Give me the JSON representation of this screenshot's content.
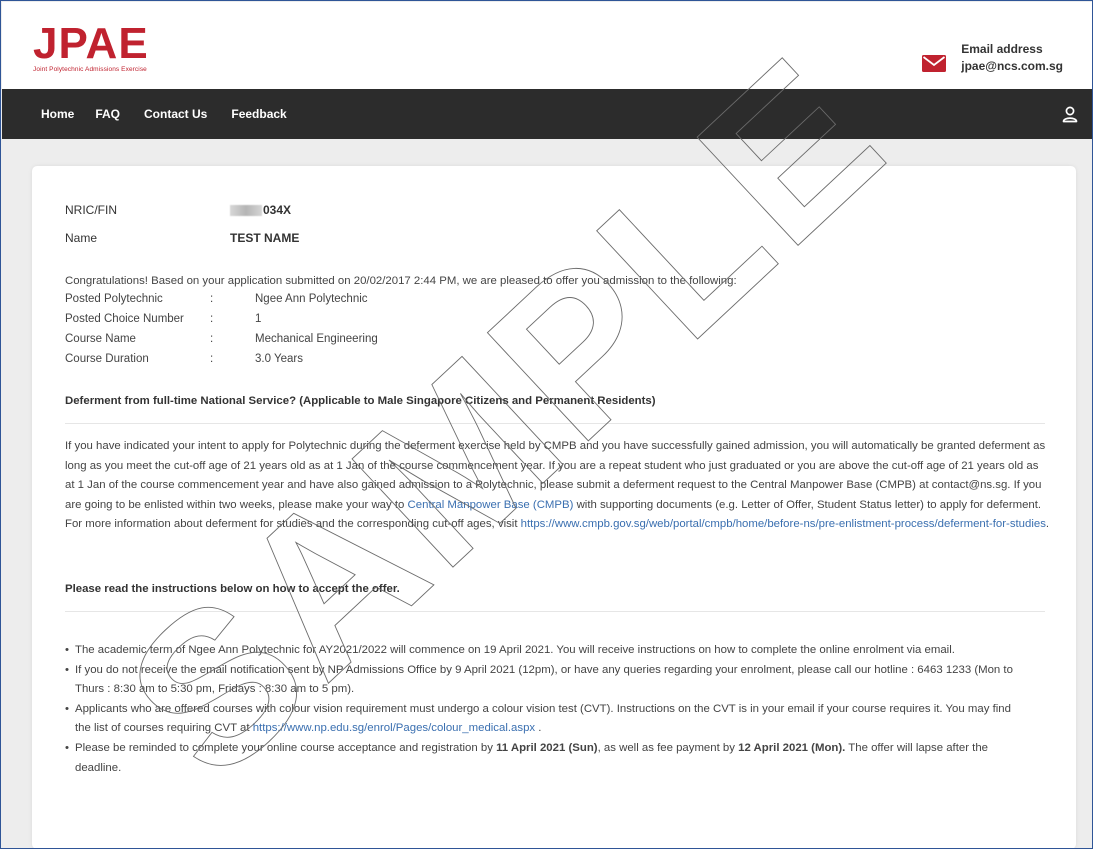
{
  "header": {
    "logo_text": "JPAE",
    "logo_subtitle": "Joint Polytechnic Admissions Exercise",
    "email_label": "Email address",
    "email_value": "jpae@ncs.com.sg"
  },
  "nav": {
    "items": [
      "Home",
      "FAQ",
      "Contact Us",
      "Feedback"
    ],
    "user_icon": "user-icon"
  },
  "profile": {
    "nric_label": "NRIC/FIN",
    "nric_value": "034X",
    "name_label": "Name",
    "name_value": "TEST NAME"
  },
  "offer": {
    "intro": "Congratulations! Based on your application submitted on 20/02/2017 2:44 PM, we are pleased to offer you admission to the following:",
    "separator": ":",
    "details": [
      {
        "label": "Posted Polytechnic",
        "value": "Ngee Ann Polytechnic"
      },
      {
        "label": "Posted Choice  Number",
        "value": "1"
      },
      {
        "label": "Course Name",
        "value": "Mechanical Engineering"
      },
      {
        "label": "Course Duration",
        "value": "3.0 Years"
      }
    ]
  },
  "deferment": {
    "heading": "Deferment from full-time National Service? (Applicable to Male Singapore Citizens and Permanent Residents)",
    "text_1": "If you have indicated your intent to apply for Polytechnic during the deferment exercise held by CMPB and you have successfully gained admission, you will automatically be granted deferment as long as you meet the cut-off age of 21 years old as at 1 Jan of the course commencement year.  If you are a repeat student who just graduated or you are above the cut-off age of 21 years old as at 1 Jan of the course commencement year and have also gained admission to a Polytechnic, please submit a deferment request to the Central Manpower Base (CMPB) at contact@ns.sg.  If you are going to be enlisted within two weeks, please make your way to ",
    "link_cmpb": "Central Manpower Base (CMPB)",
    "text_2": " with supporting documents (e.g. Letter of Offer, Student Status letter) to apply for deferment. For more information about deferment for studies and the corresponding cut-off ages, visit ",
    "link_url": "https://www.cmpb.gov.sg/web/portal/cmpb/home/before-ns/pre-enlistment-process/deferment-for-studies",
    "text_3": "."
  },
  "instructions": {
    "heading": "Please read the instructions below on how to accept the offer.",
    "bullet_1": "The academic term of Ngee Ann Polytechnic for AY2021/2022 will commence on 19 April 2021. You will receive instructions on how to complete the online enrolment via email.",
    "bullet_2": "If you do not receive the email notification sent by NP Admissions Office by 9 April 2021 (12pm), or have any queries regarding your enrolment, please call our hotline : 6463 1233 (Mon to Thurs : 8:30 am to 5:30 pm, Fridays : 8:30 am to 5 pm).",
    "bullet_3_text": "Applicants who are offered courses with colour vision requirement must undergo a colour vision test (CVT). Instructions on the CVT is in your email if your course requires it. You may find the list of courses requiring CVT at ",
    "bullet_3_link": "https://www.np.edu.sg/enrol/Pages/colour_medical.aspx",
    "bullet_3_end": " .",
    "bullet_4_a": "Please be reminded to complete your online course acceptance and registration by ",
    "bullet_4_date1": "11 April 2021 (Sun)",
    "bullet_4_b": ", as well as fee payment by ",
    "bullet_4_date2": "12 April 2021 (Mon).",
    "bullet_4_c": " The offer will lapse after the deadline."
  },
  "watermark": "SAMPLE",
  "colors": {
    "brand_red": "#c0222f",
    "nav_bg": "#2c2c2c",
    "link_blue": "#3a6fb0"
  }
}
